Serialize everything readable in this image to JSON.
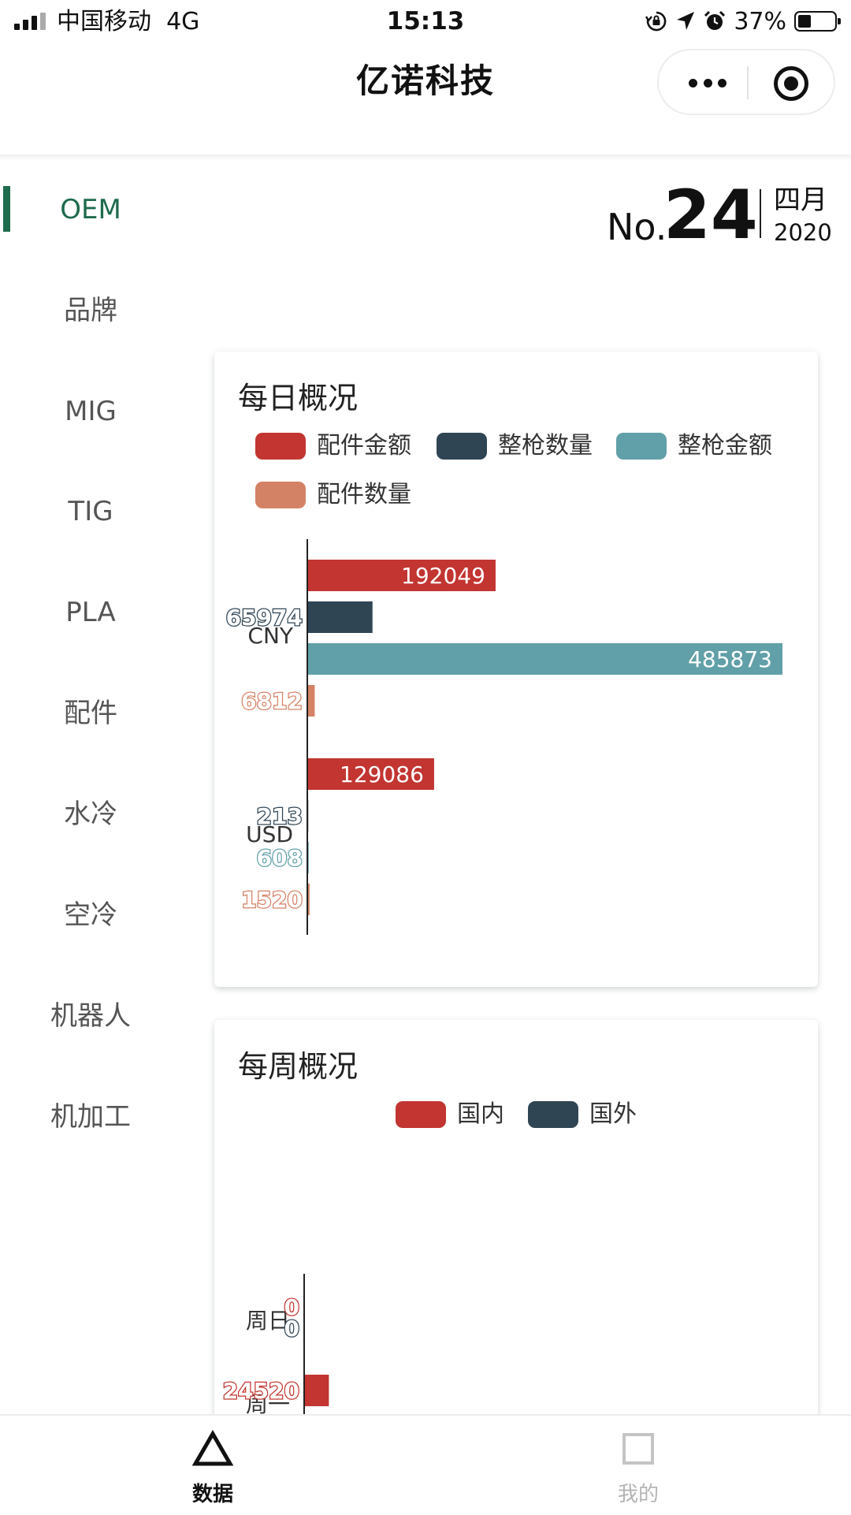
{
  "status_bar": {
    "carrier": "中国移动",
    "network": "4G",
    "time": "15:13",
    "battery": "37%",
    "battery_level": 0.37,
    "icons": [
      "signal-icon",
      "orientation-lock-icon",
      "location-arrow-icon",
      "alarm-icon",
      "battery-icon"
    ]
  },
  "nav": {
    "title": "亿诺科技",
    "capsule_icons": [
      "more-icon",
      "target-icon"
    ]
  },
  "sidebar": {
    "items": [
      {
        "label": "OEM",
        "active": true
      },
      {
        "label": "品牌",
        "active": false
      },
      {
        "label": "MIG",
        "active": false
      },
      {
        "label": "TIG",
        "active": false
      },
      {
        "label": "PLA",
        "active": false
      },
      {
        "label": "配件",
        "active": false
      },
      {
        "label": "水冷",
        "active": false
      },
      {
        "label": "空冷",
        "active": false
      },
      {
        "label": "机器人",
        "active": false
      },
      {
        "label": "机加工",
        "active": false
      }
    ]
  },
  "date": {
    "prefix": "No.",
    "day": "24",
    "month": "四月",
    "year": "2020"
  },
  "colors": {
    "accent": "#1f6b4d",
    "red": "#c23531",
    "navy": "#2f4554",
    "teal": "#61a0a8",
    "salmon": "#d48265"
  },
  "chart_data": [
    {
      "type": "bar",
      "orientation": "horizontal",
      "title": "每日概况",
      "categories": [
        "CNY",
        "USD"
      ],
      "series": [
        {
          "name": "配件金额",
          "color": "#c23531",
          "values": [
            192049,
            129086
          ]
        },
        {
          "name": "整枪数量",
          "color": "#2f4554",
          "values": [
            65974,
            213
          ]
        },
        {
          "name": "整枪金额",
          "color": "#61a0a8",
          "values": [
            485873,
            608
          ]
        },
        {
          "name": "配件数量",
          "color": "#d48265",
          "values": [
            6812,
            1520
          ]
        }
      ],
      "xlim": [
        0,
        485873
      ],
      "legend": "top",
      "grid": false
    },
    {
      "type": "bar",
      "orientation": "horizontal",
      "title": "每周概况",
      "categories": [
        "周日",
        "周一"
      ],
      "series": [
        {
          "name": "国内",
          "color": "#c23531",
          "values": [
            0,
            24520
          ]
        },
        {
          "name": "国外",
          "color": "#2f4554",
          "values": [
            0,
            null
          ]
        }
      ],
      "legend": "top",
      "grid": false
    }
  ],
  "tabbar": {
    "tabs": [
      {
        "label": "数据",
        "icon": "triangle-icon",
        "active": true
      },
      {
        "label": "我的",
        "icon": "square-icon",
        "active": false
      }
    ]
  }
}
